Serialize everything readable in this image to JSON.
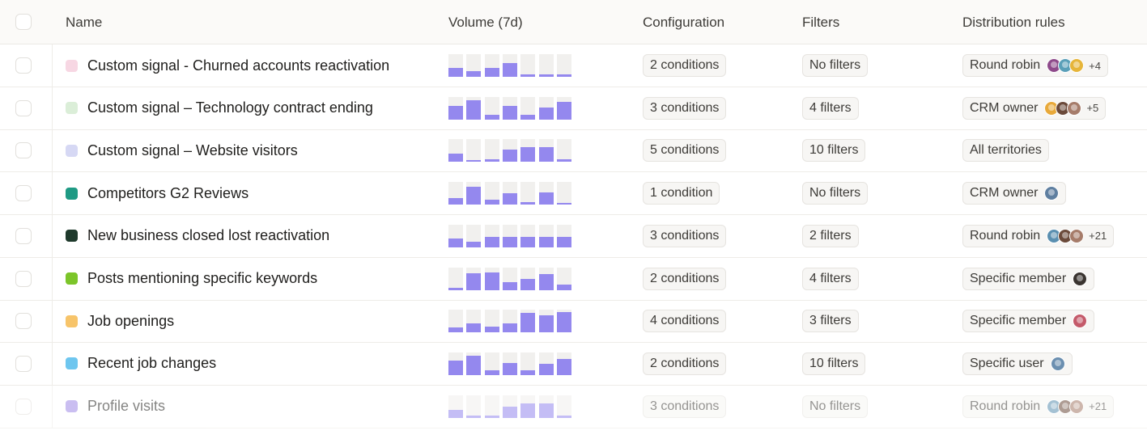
{
  "header": {
    "name": "Name",
    "volume": "Volume (7d)",
    "configuration": "Configuration",
    "filters": "Filters",
    "distribution": "Distribution rules"
  },
  "rows": [
    {
      "name": "Custom signal - Churned accounts reactivation",
      "color": "#f7d7e3",
      "volume": [
        0.4,
        0.25,
        0.4,
        0.6,
        0.1,
        0.1,
        0.1
      ],
      "configuration": "2 conditions",
      "filters": "No filters",
      "distribution": "Round robin",
      "avatars": [
        "#8e4a8a",
        "#5a9fb8",
        "#e6b53a"
      ],
      "more": "+4"
    },
    {
      "name": "Custom signal – Technology contract ending",
      "color": "#dbeed8",
      "volume": [
        0.6,
        0.85,
        0.2,
        0.6,
        0.2,
        0.55,
        0.8
      ],
      "configuration": "3 conditions",
      "filters": "4 filters",
      "distribution": "CRM owner",
      "avatars": [
        "#e8a93a",
        "#6b4a3a",
        "#a67c6a"
      ],
      "more": "+5"
    },
    {
      "name": "Custom signal – Website visitors",
      "color": "#d6d8f4",
      "volume": [
        0.35,
        0.05,
        0.1,
        0.55,
        0.65,
        0.65,
        0.1
      ],
      "configuration": "5 conditions",
      "filters": "10 filters",
      "distribution": "All territories",
      "avatars": [],
      "more": ""
    },
    {
      "name": "Competitors G2 Reviews",
      "color": "#1f9a84",
      "volume": [
        0.3,
        0.8,
        0.2,
        0.5,
        0.1,
        0.55,
        0.05
      ],
      "configuration": "1 condition",
      "filters": "No filters",
      "distribution": "CRM owner",
      "avatars": [
        "#5f7fa0"
      ],
      "more": ""
    },
    {
      "name": "New business closed lost reactivation",
      "color": "#1f3a2c",
      "volume": [
        0.4,
        0.25,
        0.45,
        0.45,
        0.45,
        0.45,
        0.45
      ],
      "configuration": "3 conditions",
      "filters": "2 filters",
      "distribution": "Round robin",
      "avatars": [
        "#5a8fb0",
        "#6b4a3a",
        "#a67c6a"
      ],
      "more": "+21"
    },
    {
      "name": "Posts mentioning specific keywords",
      "color": "#7cc52a",
      "volume": [
        0.1,
        0.75,
        0.8,
        0.35,
        0.5,
        0.7,
        0.25
      ],
      "configuration": "2 conditions",
      "filters": "4 filters",
      "distribution": "Specific member",
      "avatars": [
        "#3a3430"
      ],
      "more": ""
    },
    {
      "name": "Job openings",
      "color": "#f7c46a",
      "volume": [
        0.2,
        0.4,
        0.25,
        0.4,
        0.85,
        0.75,
        0.9
      ],
      "configuration": "4 conditions",
      "filters": "3 filters",
      "distribution": "Specific member",
      "avatars": [
        "#c45a6a"
      ],
      "more": ""
    },
    {
      "name": "Recent job changes",
      "color": "#6ec6ef",
      "volume": [
        0.65,
        0.85,
        0.2,
        0.55,
        0.2,
        0.5,
        0.7
      ],
      "configuration": "2 conditions",
      "filters": "10 filters",
      "distribution": "Specific user",
      "avatars": [
        "#6b8fb0"
      ],
      "more": ""
    },
    {
      "name": "Profile visits",
      "color": "#9f8ae6",
      "volume": [
        0.35,
        0.1,
        0.1,
        0.5,
        0.65,
        0.65,
        0.1
      ],
      "configuration": "3 conditions",
      "filters": "No filters",
      "distribution": "Round robin",
      "avatars": [
        "#5a8fb0",
        "#6b4a3a",
        "#a67c6a"
      ],
      "more": "+21"
    }
  ]
}
